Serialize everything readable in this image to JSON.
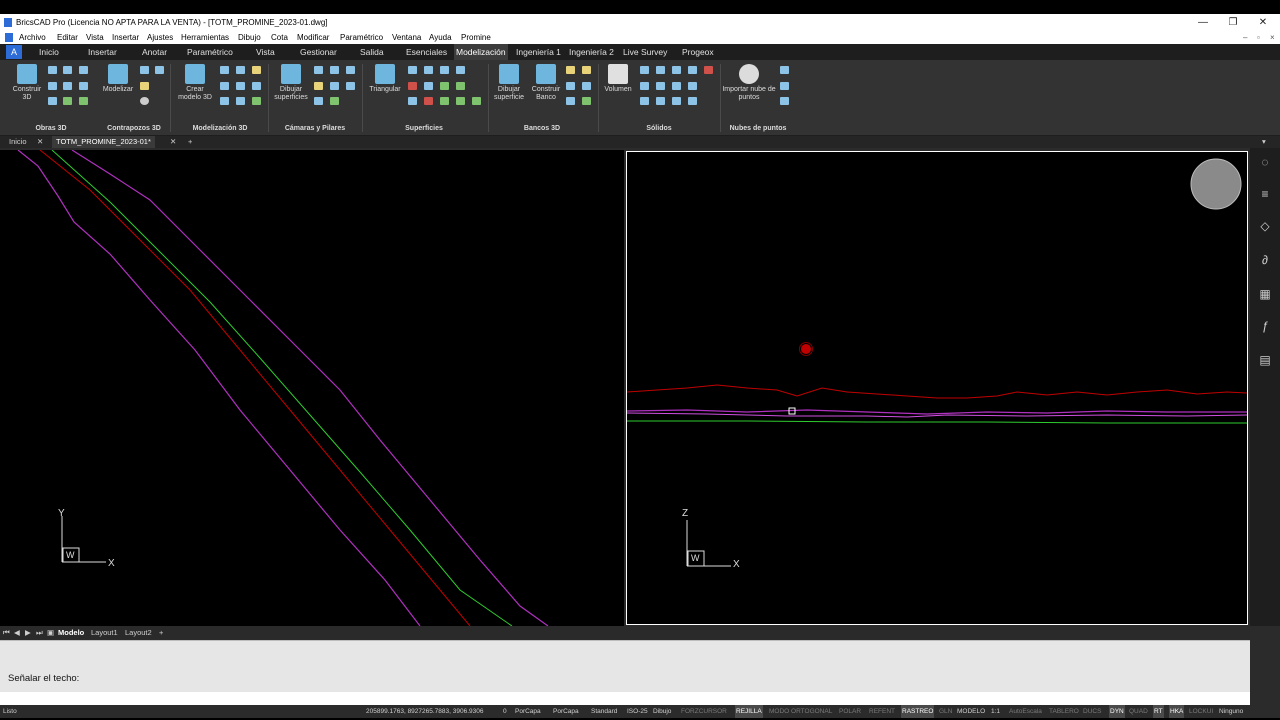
{
  "window": {
    "title": "BricsCAD Pro (Licencia NO APTA PARA LA VENTA) - [TOTM_PROMINE_2023-01.dwg]",
    "min": "—",
    "max": "❐",
    "close": "✕"
  },
  "menu": [
    "Archivo",
    "Editar",
    "Vista",
    "Insertar",
    "Ajustes",
    "Herramientas",
    "Dibujo",
    "Cota",
    "Modificar",
    "Paramétrico",
    "Ventana",
    "Ayuda",
    "Promine"
  ],
  "ribbon_tabs": [
    "Inicio",
    "Insertar",
    "Anotar",
    "Paramétrico",
    "Vista",
    "Gestionar",
    "Salida",
    "Esenciales",
    "Modelización",
    "Ingeniería 1",
    "Ingeniería 2",
    "Live Survey",
    "Progeox"
  ],
  "active_ribbon_tab": "Modelización",
  "ribbon": {
    "big_buttons": [
      "Construir 3D",
      "Modelizar",
      "Crear modelo 3D",
      "Dibujar superficies",
      "Triangular",
      "Dibujar superficie",
      "Construir Banco",
      "Volumen",
      "Importar nube de puntos"
    ],
    "groups": [
      "Obras 3D",
      "Contrapozos 3D",
      "Modelización 3D",
      "Cámaras y Pilares",
      "Superficies",
      "Bancos 3D",
      "Sólidos",
      "Nubes de puntos"
    ]
  },
  "doc_tabs": {
    "home": "Inicio",
    "file": "TOTM_PROMINE_2023-01*",
    "close": "✕",
    "add": "+"
  },
  "viewports": {
    "left": {
      "axis_x": "X",
      "axis_y": "Y",
      "ucs": "W"
    },
    "right": {
      "axis_x": "X",
      "axis_z": "Z",
      "ucs": "W"
    }
  },
  "layout_tabs": [
    "Modelo",
    "Layout1",
    "Layout2",
    "+"
  ],
  "active_layout": "Modelo",
  "command": {
    "prompt": "Señalar el techo:"
  },
  "status": {
    "ready": "Listo",
    "coords": "205899.1763, 8927265.7883, 3906.9306",
    "items": [
      {
        "t": "0",
        "s": ""
      },
      {
        "t": "PorCapa",
        "s": ""
      },
      {
        "t": "PorCapa",
        "s": ""
      },
      {
        "t": "Standard",
        "s": ""
      },
      {
        "t": "ISO-25",
        "s": ""
      },
      {
        "t": "Dibujo",
        "s": ""
      },
      {
        "t": "FORZCURSOR",
        "s": "dim"
      },
      {
        "t": "REJILLA",
        "s": "on"
      },
      {
        "t": "MODO ORTOGONAL",
        "s": "dim"
      },
      {
        "t": "POLAR",
        "s": "dim"
      },
      {
        "t": "REFENT",
        "s": "dim"
      },
      {
        "t": "RASTREO",
        "s": "on"
      },
      {
        "t": "GLN",
        "s": "dim"
      },
      {
        "t": "MODELO",
        "s": ""
      },
      {
        "t": "1:1",
        "s": ""
      },
      {
        "t": "AutoEscala",
        "s": "dim"
      },
      {
        "t": "TABLERO",
        "s": "dim"
      },
      {
        "t": "DUCS",
        "s": "dim"
      },
      {
        "t": "DYN",
        "s": "on"
      },
      {
        "t": "QUAD",
        "s": "dim"
      },
      {
        "t": "RT",
        "s": "on"
      },
      {
        "t": "HKA",
        "s": "on"
      },
      {
        "t": "LOCKUI",
        "s": "dim"
      },
      {
        "t": "Ninguno",
        "s": ""
      }
    ]
  },
  "colors": {
    "red_line": "#c00000",
    "green_line": "#2ecc2e",
    "magenta_line": "#b030c0",
    "accent": "#2d6bd6"
  }
}
